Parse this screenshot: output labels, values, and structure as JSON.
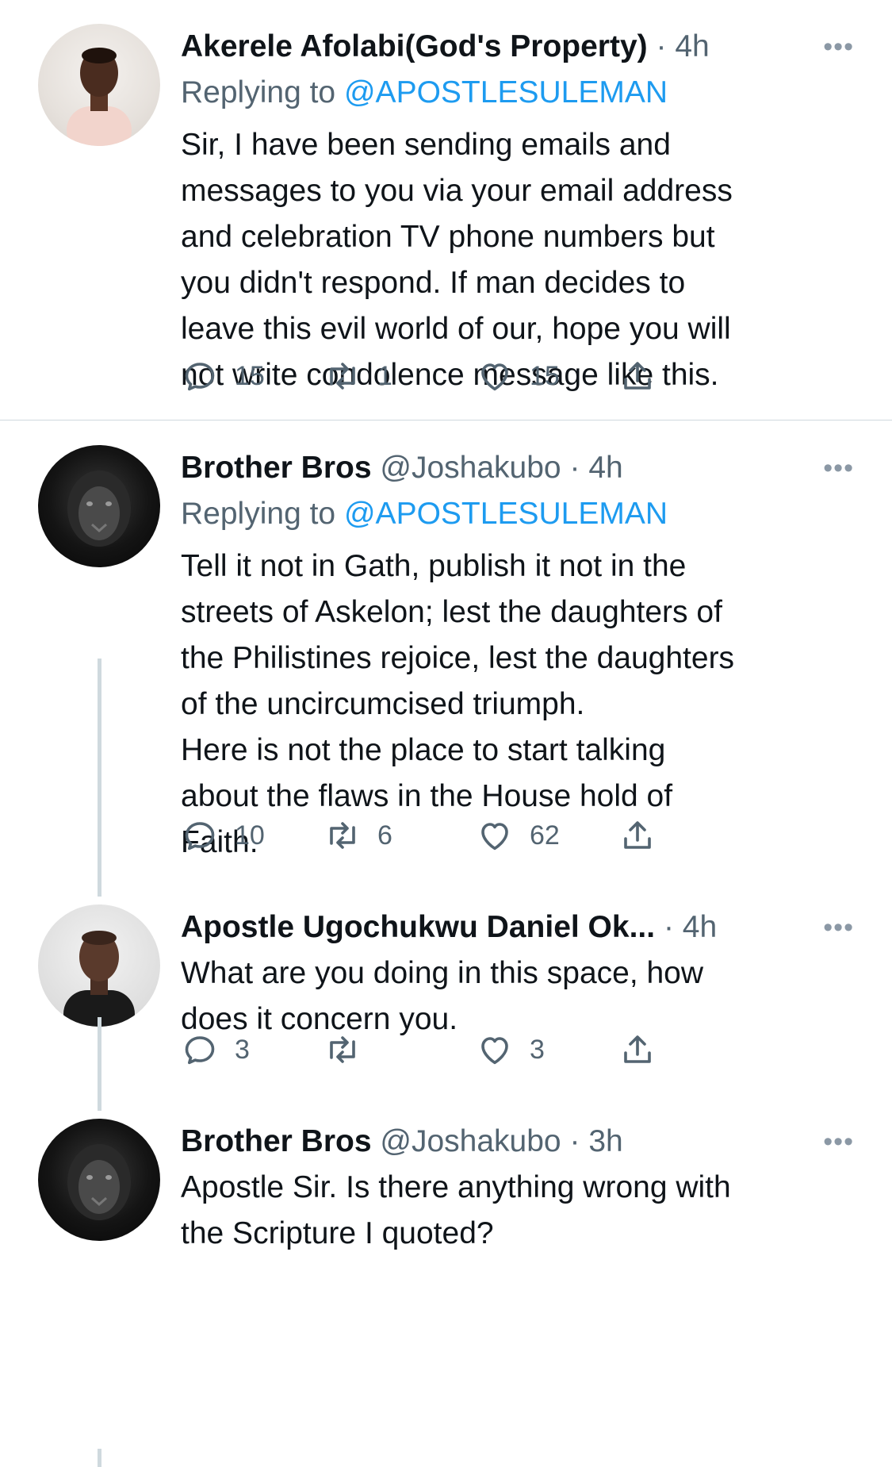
{
  "tweets": [
    {
      "name": "Akerele Afolabi(God's Property)",
      "handle": "",
      "dot": "·",
      "time": "4h",
      "more": "•••",
      "replying_label": "Replying to",
      "replying_to": "@APOSTLESULEMAN",
      "text": "Sir, I have been sending emails and\nmessages to you via your email address\nand celebration TV phone numbers but\nyou didn't respond. If man decides to\nleave this evil world of our, hope you will\nnot write condolence message like this.",
      "replies": "15",
      "retweets": "1",
      "likes": "15"
    },
    {
      "name": "Brother Bros",
      "handle": "@Joshakubo",
      "dot": "·",
      "time": "4h",
      "more": "•••",
      "replying_label": "Replying to",
      "replying_to": "@APOSTLESULEMAN",
      "text": "Tell it not in Gath, publish it not in the\nstreets of Askelon; lest the daughters of\nthe Philistines rejoice, lest the daughters\nof the uncircumcised triumph.\nHere is not the place to start talking\nabout the flaws in the House hold of\nFaith.",
      "replies": "10",
      "retweets": "6",
      "likes": "62"
    },
    {
      "name": "Apostle Ugochukwu Daniel Ok...",
      "handle": "",
      "dot": "·",
      "time": "4h",
      "more": "•••",
      "text": "What are you doing in this space, how\ndoes it concern you.",
      "replies": "3",
      "retweets": "",
      "likes": "3"
    },
    {
      "name": "Brother Bros",
      "handle": "@Joshakubo",
      "dot": "·",
      "time": "3h",
      "more": "•••",
      "text": "Apostle Sir. Is there anything wrong with\nthe Scripture I quoted?"
    }
  ],
  "icons": [
    "reply-icon",
    "retweet-icon",
    "like-icon",
    "share-icon",
    "more-icon"
  ],
  "colors": {
    "link": "#1d9bf0",
    "secondary": "#536471",
    "divider": "#cfd9de"
  }
}
